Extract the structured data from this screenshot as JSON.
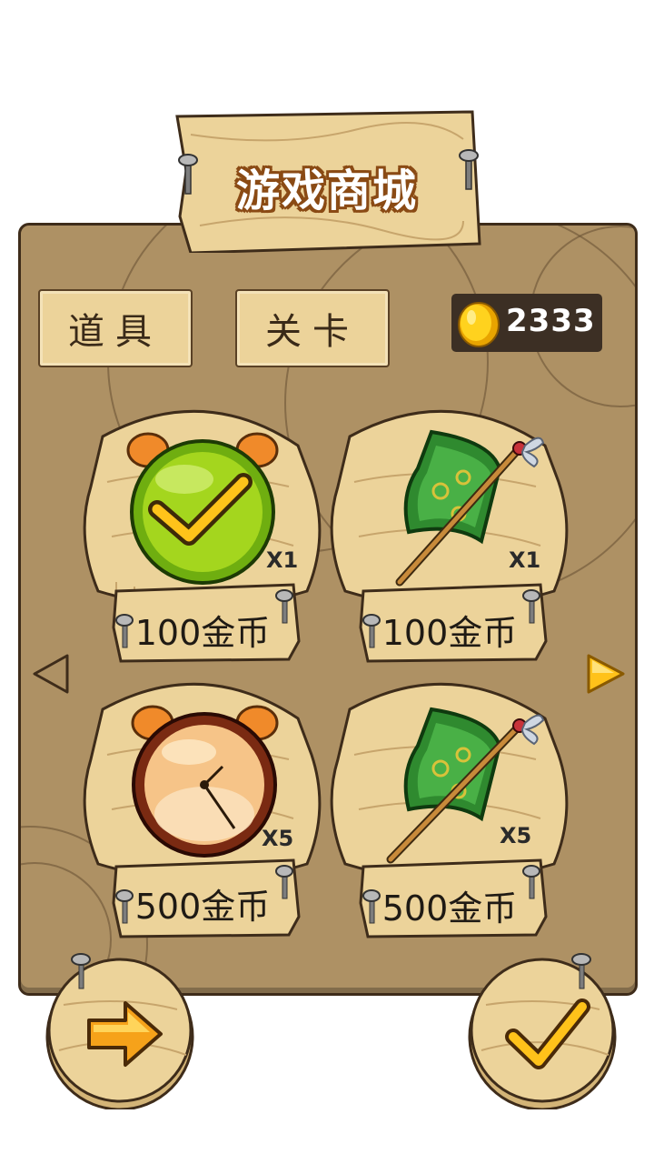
{
  "title": "游戏商城",
  "tabs": [
    {
      "label": "道具"
    },
    {
      "label": "关卡"
    }
  ],
  "coins": "2333",
  "items": [
    {
      "icon": "green-check-alarm-icon",
      "qty": "X1",
      "price": "100金币"
    },
    {
      "icon": "magic-fan-icon",
      "qty": "X1",
      "price": "100金币"
    },
    {
      "icon": "alarm-clock-icon",
      "qty": "X5",
      "price": "500金币"
    },
    {
      "icon": "magic-fan-icon",
      "qty": "X5",
      "price": "500金币"
    }
  ],
  "nav": {
    "prev_icon": "triangle-left-icon",
    "next_icon": "triangle-right-icon"
  },
  "buttons": {
    "back_icon": "orange-arrow-right-icon",
    "confirm_icon": "yellow-check-icon"
  },
  "colors": {
    "panel": "#ae9164",
    "wood": "#ecd39a",
    "title_outline": "#8a4a14",
    "coin_box": "#3c2f24"
  }
}
